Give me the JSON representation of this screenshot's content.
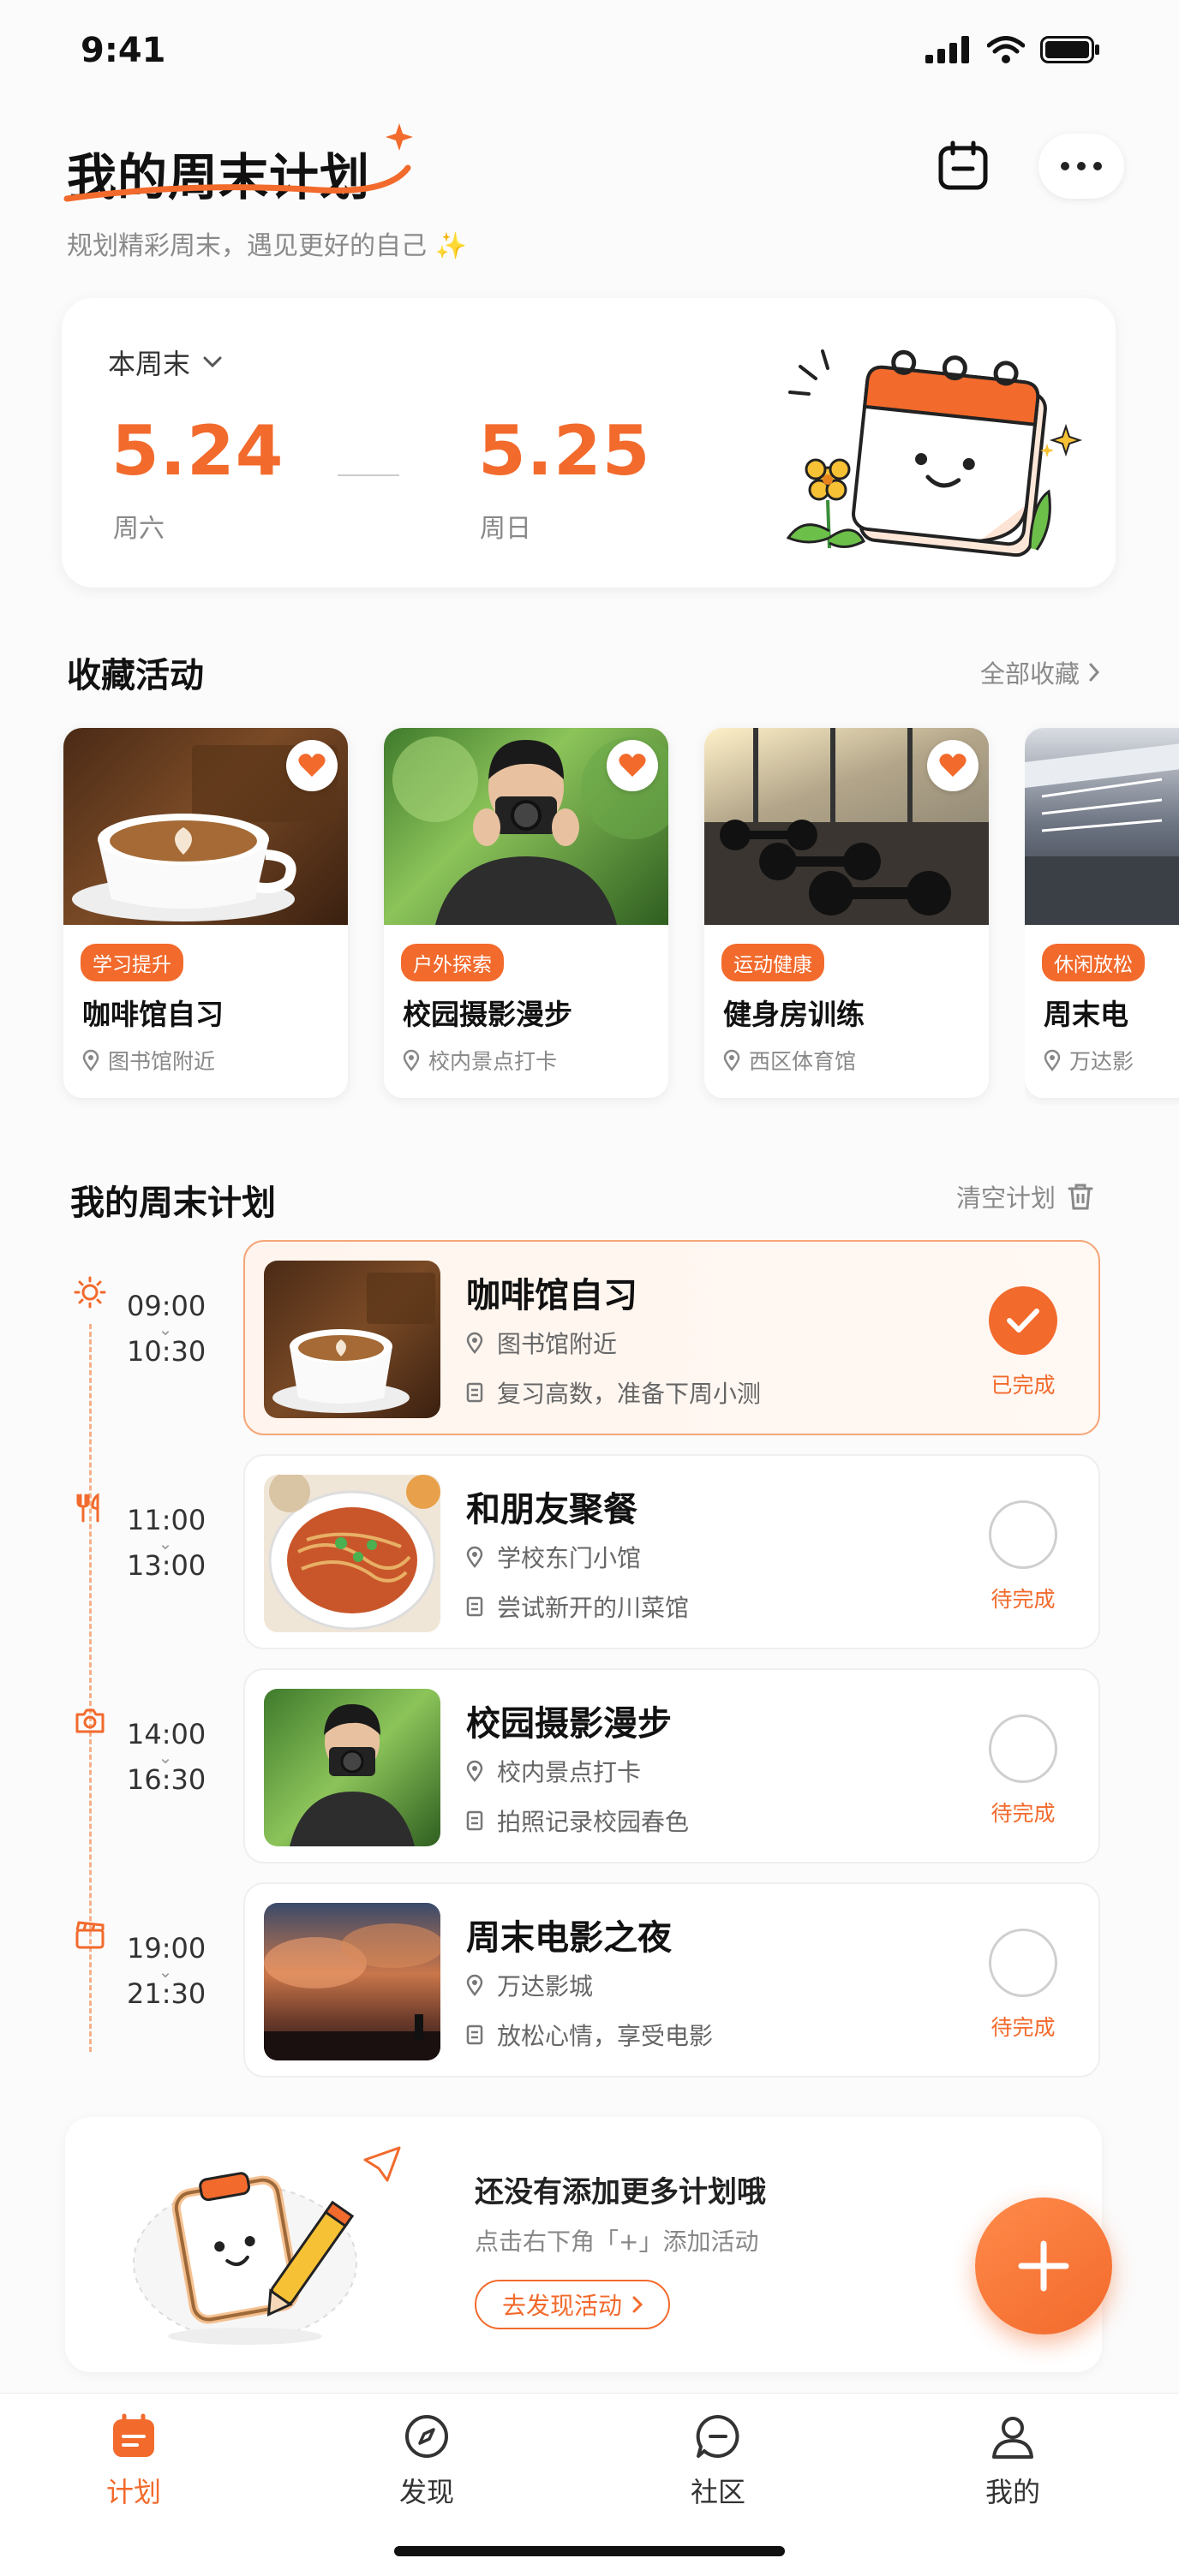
{
  "status": {
    "time": "9:41"
  },
  "header": {
    "title": "我的周末计划",
    "subtitle": "规划精彩周末，遇见更好的自己 ✨"
  },
  "week": {
    "selector": "本周末",
    "sat_date": "5.24",
    "sat_label": "周六",
    "sun_date": "5.25",
    "sun_label": "周日"
  },
  "favorites": {
    "title": "收藏活动",
    "link": "全部收藏",
    "items": [
      {
        "tag": "学习提升",
        "title": "咖啡馆自习",
        "location": "图书馆附近"
      },
      {
        "tag": "户外探索",
        "title": "校园摄影漫步",
        "location": "校内景点打卡"
      },
      {
        "tag": "运动健康",
        "title": "健身房训练",
        "location": "西区体育馆"
      },
      {
        "tag": "休闲放松",
        "title": "周末电",
        "location": "万达影"
      }
    ]
  },
  "plan": {
    "title": "我的周末计划",
    "clear": "清空计划",
    "items": [
      {
        "start": "09:00",
        "end": "10:30",
        "title": "咖啡馆自习",
        "location": "图书馆附近",
        "note": "复习高数，准备下周小测",
        "status": "已完成",
        "done": true
      },
      {
        "start": "11:00",
        "end": "13:00",
        "title": "和朋友聚餐",
        "location": "学校东门小馆",
        "note": "尝试新开的川菜馆",
        "status": "待完成",
        "done": false
      },
      {
        "start": "14:00",
        "end": "16:30",
        "title": "校园摄影漫步",
        "location": "校内景点打卡",
        "note": "拍照记录校园春色",
        "status": "待完成",
        "done": false
      },
      {
        "start": "19:00",
        "end": "21:30",
        "title": "周末电影之夜",
        "location": "万达影城",
        "note": "放松心情，享受电影",
        "status": "待完成",
        "done": false
      }
    ]
  },
  "empty": {
    "title": "还没有添加更多计划哦",
    "hint": "点击右下角「+」添加活动",
    "button": "去发现活动"
  },
  "tabs": [
    {
      "label": "计划",
      "icon": "plan-icon",
      "active": true
    },
    {
      "label": "发现",
      "icon": "compass-icon",
      "active": false
    },
    {
      "label": "社区",
      "icon": "chat-icon",
      "active": false
    },
    {
      "label": "我的",
      "icon": "user-icon",
      "active": false
    }
  ],
  "colors": {
    "accent": "#f26a2c"
  }
}
